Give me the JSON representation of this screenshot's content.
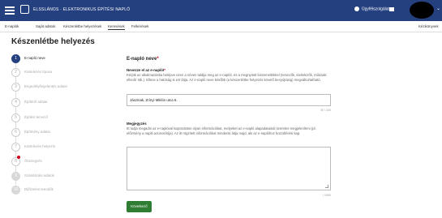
{
  "header": {
    "app_title": "ELSSLÁNOS · ELEKTRONIKUS ÉPÍTÉSI NAPLÓ",
    "support_label": "Ügyfélszolgálat",
    "colors": {
      "bar": "#25407f",
      "accent_green": "#2e7d32",
      "required": "#d0021b"
    }
  },
  "subnav": {
    "items": [
      "E-naplók",
      "Saját adatok",
      "Készenlétbe helyezések",
      "Keresések",
      "Felkérések"
    ],
    "right": "Kézikönyvek"
  },
  "page": {
    "title": "Készenlétbe helyezés"
  },
  "steps": [
    {
      "num": "1",
      "label": "E-napló neve"
    },
    {
      "num": "2",
      "label": "Kivitelezés típusa"
    },
    {
      "num": "3",
      "label": "Engedély/bejelentés adatai"
    },
    {
      "num": "4",
      "label": "Építtető adatai"
    },
    {
      "num": "5",
      "label": "Építési tervező"
    },
    {
      "num": "6",
      "label": "Építmény adatai"
    },
    {
      "num": "7",
      "label": "Kivitelezés helyszín"
    },
    {
      "num": "8",
      "label": "Összegzés"
    },
    {
      "num": "9",
      "label": "Számlázási adatok"
    },
    {
      "num": "10",
      "label": "Díjfizetési teendők"
    }
  ],
  "form": {
    "section_title": "E-napló neve",
    "required_mark": "*",
    "name_label": "Nevezze el az e-naplót",
    "name_help": "Kérjük az alkalmazásba belépve ezen a néven találja meg az e-naplót, és a megnyitott kiszemeltökkel (tervezők, kivitelezők, műszaki ellenőr stb.). Ellene a hatóság is ezt látja. Az e-napló neve később (a készenlétbe helyezés követő benyújtásig) megváltoztatható.",
    "name_value": "Jászinak, Zrínyi Miklós utca 6.",
    "name_counter": "30 / 100",
    "note_label": "Megjegyzés",
    "note_help": "Itt tudja megadni az e-naplóval kapcsolatos olyan információkat, melyeket az e-napló alapadatainál szeretne megjeleníteni (pl. előzmény a napló azonosítója). Az itt rögzített információkat mindenki látja majd, aki az e-naplóhoz hozzáférési kap.",
    "note_value": "",
    "note_counter": "/ 1000",
    "next_button": "Következő"
  }
}
